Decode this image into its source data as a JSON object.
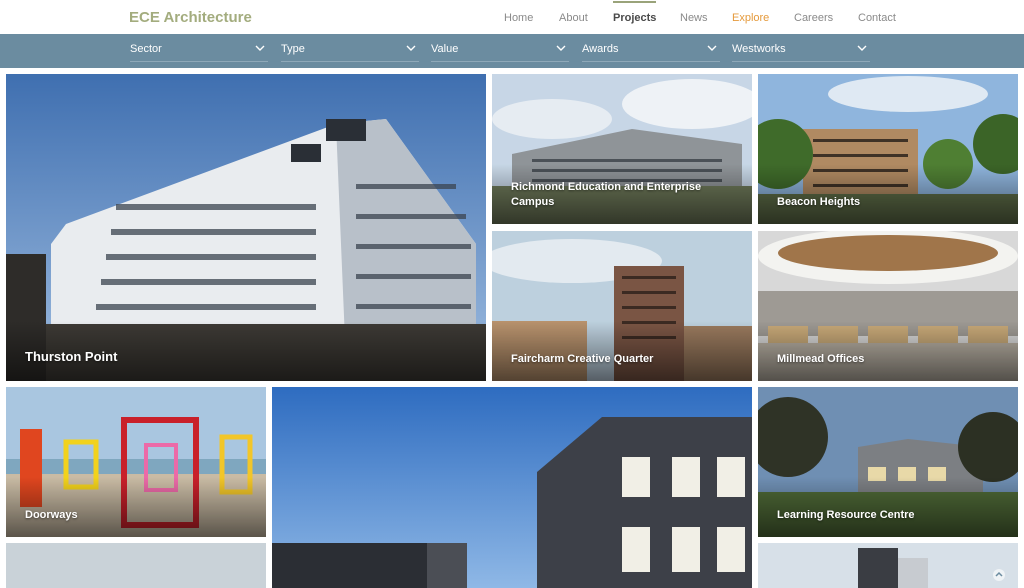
{
  "header": {
    "logo": "ECE Architecture",
    "nav": [
      "Home",
      "About",
      "Projects",
      "News",
      "Explore",
      "Careers",
      "Contact"
    ],
    "active": "Projects"
  },
  "filters": [
    {
      "label": "Sector"
    },
    {
      "label": "Type"
    },
    {
      "label": "Value"
    },
    {
      "label": "Awards"
    },
    {
      "label": "Westworks"
    }
  ],
  "projects": [
    {
      "title": "Thurston Point"
    },
    {
      "title": "Richmond Education and Enterprise Campus"
    },
    {
      "title": "Beacon Heights"
    },
    {
      "title": "Faircharm Creative Quarter"
    },
    {
      "title": "Millmead Offices"
    },
    {
      "title": "Doorways"
    },
    {
      "title": "Learning Resource Centre"
    },
    {
      "title": ""
    },
    {
      "title": ""
    },
    {
      "title": ""
    }
  ],
  "colors": {
    "brand": "#a3ac7e",
    "filterbar": "#6b8ca0",
    "explore": "#e59a3c"
  }
}
